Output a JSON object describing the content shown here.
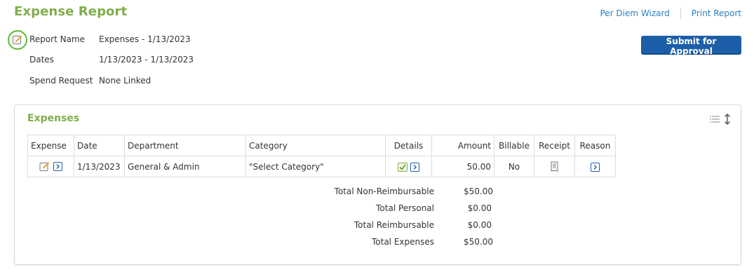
{
  "header": {
    "title": "Expense Report",
    "per_diem_link": "Per Diem Wizard",
    "print_link": "Print Report"
  },
  "report": {
    "name_label": "Report Name",
    "name_value": "Expenses - 1/13/2023",
    "dates_label": "Dates",
    "dates_value": "1/13/2023 - 1/13/2023",
    "spend_label": "Spend Request",
    "spend_value": "None Linked",
    "submit_label": "Submit for Approval"
  },
  "expenses": {
    "title": "Expenses",
    "columns": [
      "Expense",
      "Date",
      "Department",
      "Category",
      "Details",
      "Amount",
      "Billable",
      "Receipt",
      "Reason"
    ],
    "rows": [
      {
        "date": "1/13/2023",
        "department": "General & Admin",
        "category": "\"Select Category\"",
        "amount": "50.00",
        "billable": "No"
      }
    ],
    "totals": [
      {
        "label": "Total Non-Reimbursable",
        "value": "$50.00"
      },
      {
        "label": "Total Personal",
        "value": "$0.00"
      },
      {
        "label": "Total Reimbursable",
        "value": "$0.00"
      },
      {
        "label": "Total Expenses",
        "value": "$50.00"
      }
    ]
  },
  "colors": {
    "accent_green": "#7fae4a",
    "link_blue": "#2c7fc4",
    "button_blue": "#1c5fa8",
    "highlight_ring": "#5cb83a"
  },
  "icons": [
    "edit-icon",
    "arrow-right-icon",
    "checkmark-icon",
    "receipt-icon",
    "list-view-icon",
    "sort-vertical-icon"
  ]
}
